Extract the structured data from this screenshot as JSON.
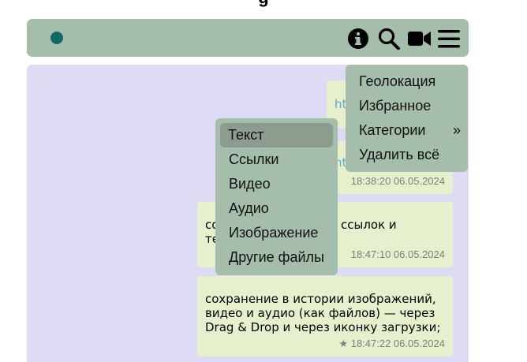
{
  "header": {
    "status_color": "#0e6b63",
    "icons": [
      "info-icon",
      "search-icon",
      "video-icon",
      "menu-icon"
    ]
  },
  "messages": [
    {
      "text_lines": [
        "ht"
      ],
      "time": ""
    },
    {
      "text_lines": [
        "nt"
      ],
      "time": "18:38:20 06.05.2024"
    },
    {
      "text_lines": [
        "со",
        "те"
      ],
      "text_tail": "ссылок и",
      "time": "18:47:10 06.05.2024"
    },
    {
      "text_lines": [
        "сохранение в истории изображений,",
        "видео и аудио (как файлов) — через",
        "Drag & Drop и через иконку загрузки;"
      ],
      "time": "18:47:22 06.05.2024",
      "starred": "★"
    }
  ],
  "main_menu": {
    "items": [
      {
        "label": "Геолокация"
      },
      {
        "label": "Избранное"
      },
      {
        "label": "Категории",
        "arrow": "»"
      },
      {
        "label": "Удалить всё"
      }
    ]
  },
  "category_menu": {
    "items": [
      {
        "label": "Текст",
        "selected": true
      },
      {
        "label": "Ссылки"
      },
      {
        "label": "Видео"
      },
      {
        "label": "Аудио"
      },
      {
        "label": "Изображение"
      },
      {
        "label": "Другие файлы"
      }
    ]
  }
}
